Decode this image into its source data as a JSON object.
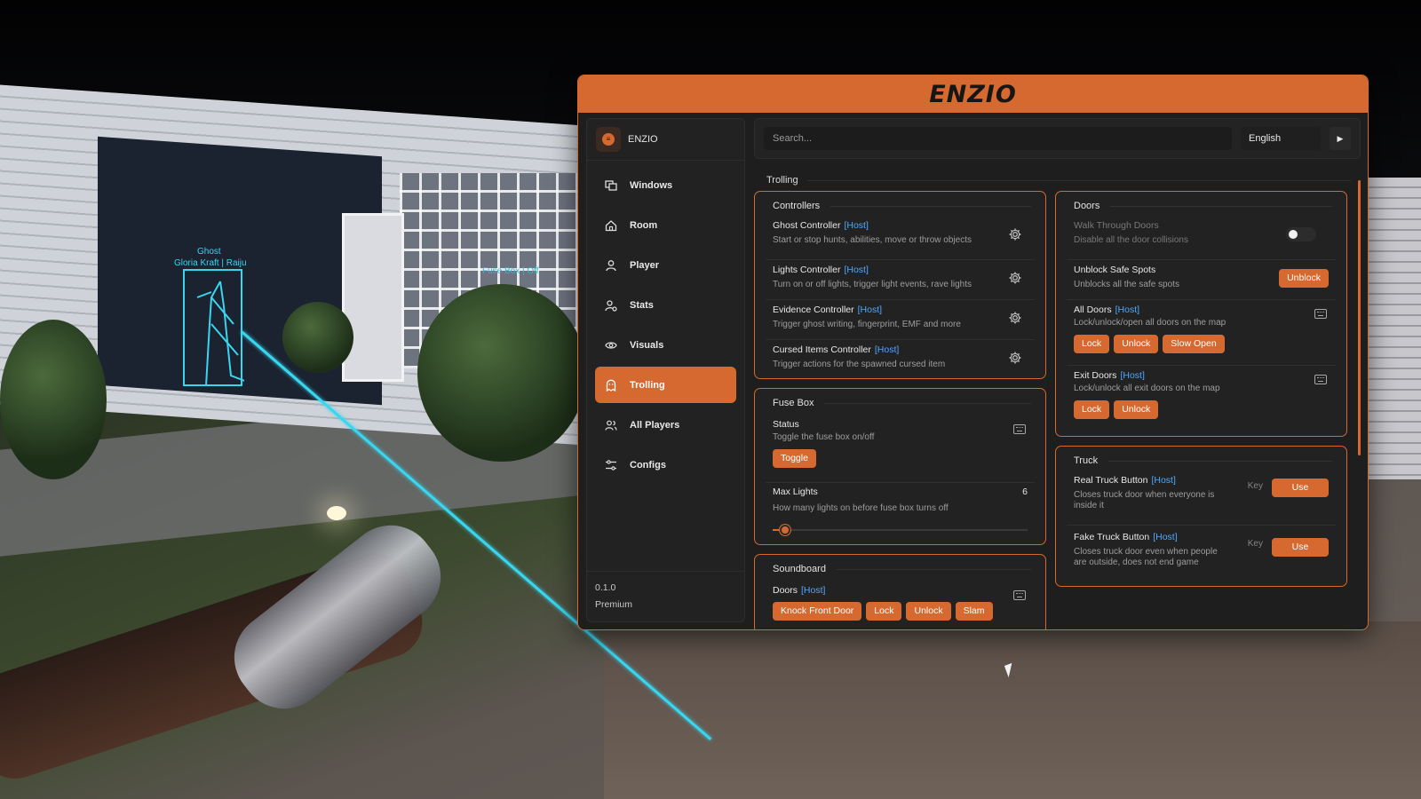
{
  "overlay": {
    "ghost_label": "Ghost",
    "ghost_name": "Gloria Kraft | Raiju",
    "fuse_box_label": "Fuse Box | Off"
  },
  "app": {
    "logo": "ENZIO",
    "accent": "#d6692f"
  },
  "sidebar": {
    "title": "ENZIO",
    "items": [
      {
        "label": "Windows",
        "icon": "windows-icon"
      },
      {
        "label": "Room",
        "icon": "home-icon"
      },
      {
        "label": "Player",
        "icon": "user-icon"
      },
      {
        "label": "Stats",
        "icon": "stats-user-icon"
      },
      {
        "label": "Visuals",
        "icon": "eye-icon"
      },
      {
        "label": "Trolling",
        "icon": "ghost-icon",
        "active": true
      },
      {
        "label": "All Players",
        "icon": "users-icon"
      },
      {
        "label": "Configs",
        "icon": "sliders-icon"
      }
    ],
    "version": "0.1.0",
    "tier": "Premium"
  },
  "topbar": {
    "search_placeholder": "Search...",
    "language": "English"
  },
  "section": "Trolling",
  "host_tag": "[Host]",
  "controllers": {
    "title": "Controllers",
    "rows": [
      {
        "title": "Ghost Controller",
        "desc": "Start or stop hunts, abilities, move or throw objects"
      },
      {
        "title": "Lights Controller",
        "desc": "Turn on or off lights, trigger light events, rave lights"
      },
      {
        "title": "Evidence Controller",
        "desc": "Trigger ghost writing, fingerprint, EMF and more"
      },
      {
        "title": "Cursed Items Controller",
        "desc": "Trigger actions for the spawned cursed item"
      }
    ]
  },
  "fuse_box": {
    "title": "Fuse Box",
    "status_title": "Status",
    "status_desc": "Toggle the fuse box on/off",
    "toggle_label": "Toggle",
    "max_lights_title": "Max Lights",
    "max_lights_desc": "How many lights on before fuse box turns off",
    "max_lights_value": "6",
    "max_lights_fraction": 0.05
  },
  "soundboard": {
    "title": "Soundboard",
    "doors_title": "Doors",
    "buttons": [
      "Knock Front Door",
      "Lock",
      "Unlock",
      "Slam"
    ]
  },
  "doors": {
    "title": "Doors",
    "walk_title": "Walk Through Doors",
    "walk_desc": "Disable all the door collisions",
    "walk_enabled": false,
    "safe_title": "Unblock Safe Spots",
    "safe_desc": "Unblocks all the safe spots",
    "safe_button": "Unblock",
    "all_title": "All Doors",
    "all_desc": "Lock/unlock/open all doors on the map",
    "all_buttons": [
      "Lock",
      "Unlock",
      "Slow Open"
    ],
    "exit_title": "Exit Doors",
    "exit_desc": "Lock/unlock all exit doors on the map",
    "exit_buttons": [
      "Lock",
      "Unlock"
    ]
  },
  "truck": {
    "title": "Truck",
    "real_title": "Real Truck Button",
    "real_desc": "Closes truck door when everyone is inside it",
    "fake_title": "Fake Truck Button",
    "fake_desc": "Closes truck door even when people are outside, does not end game",
    "key_label": "Key",
    "use_label": "Use"
  }
}
